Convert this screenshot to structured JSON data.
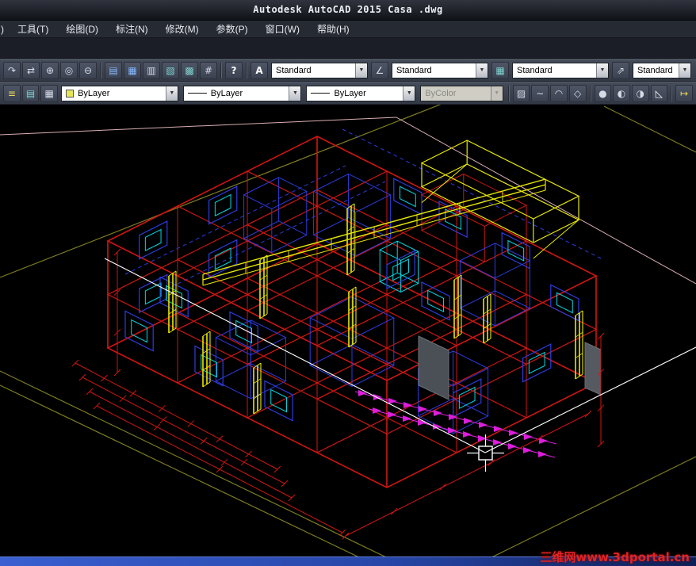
{
  "window": {
    "title": "Autodesk AutoCAD 2015   Casa .dwg"
  },
  "menubar": {
    "items": [
      {
        "label": ")"
      },
      {
        "label": "工具(T)"
      },
      {
        "label": "绘图(D)"
      },
      {
        "label": "标注(N)"
      },
      {
        "label": "修改(M)"
      },
      {
        "label": "参数(P)"
      },
      {
        "label": "窗口(W)"
      },
      {
        "label": "帮助(H)"
      }
    ]
  },
  "ui": {
    "dropdown_arrow": "▼"
  },
  "toolbar_row1": {
    "buttons": [
      {
        "name": "redo",
        "glyph": "↷"
      },
      {
        "name": "pan",
        "glyph": "⇄"
      },
      {
        "name": "zoom-in",
        "glyph": "⊕"
      },
      {
        "name": "zoom-realtime",
        "glyph": "◎"
      },
      {
        "name": "zoom-previous",
        "glyph": "⊖"
      },
      {
        "name": "save",
        "glyph": "▤"
      },
      {
        "name": "plot",
        "glyph": "▦"
      },
      {
        "name": "plot-preview",
        "glyph": "▥"
      },
      {
        "name": "publish",
        "glyph": "▧"
      },
      {
        "name": "table",
        "glyph": "▩"
      },
      {
        "name": "quickcalc",
        "glyph": "#"
      },
      {
        "name": "help",
        "glyph": "?"
      },
      {
        "name": "text-style",
        "glyph": "A"
      }
    ],
    "inter_icons": [
      {
        "name": "dim-style",
        "glyph": "∠"
      },
      {
        "name": "table-style",
        "glyph": "▦"
      },
      {
        "name": "multileader-style",
        "glyph": "⇗"
      }
    ],
    "combos": [
      {
        "name": "text-style",
        "value": "Standard"
      },
      {
        "name": "dim-style",
        "value": "Standard"
      },
      {
        "name": "table-style",
        "value": "Standard"
      },
      {
        "name": "multileader-style",
        "value": "Standard"
      }
    ]
  },
  "toolbar_row2": {
    "buttons_left": [
      {
        "name": "layer-properties",
        "glyph": "≡"
      },
      {
        "name": "layer-states",
        "glyph": "▤"
      },
      {
        "name": "layer-make-current",
        "glyph": "▦"
      }
    ],
    "color_combo": {
      "value": "ByLayer",
      "swatch_color": "#e6e65a"
    },
    "linetype_combo": {
      "value": "ByLayer"
    },
    "lineweight_combo": {
      "value": "ByLayer"
    },
    "plot_style_combo": {
      "value": "ByColor"
    },
    "buttons_right": [
      {
        "name": "match-properties",
        "glyph": "▨"
      },
      {
        "name": "polyline",
        "glyph": "∼"
      },
      {
        "name": "arc",
        "glyph": "◠"
      },
      {
        "name": "region",
        "glyph": "◇"
      },
      {
        "name": "render-sphere-1",
        "glyph": "●"
      },
      {
        "name": "render-sphere-2",
        "glyph": "◐"
      },
      {
        "name": "render-sphere-3",
        "glyph": "◑"
      },
      {
        "name": "face-tool",
        "glyph": "◺"
      },
      {
        "name": "measure",
        "glyph": "↦"
      }
    ]
  },
  "canvas": {
    "watermark": "三维网www.3dportal.cn"
  },
  "colors": {
    "wire_red": "#cf1612",
    "wire_blue": "#2e3ce0",
    "wire_cyan": "#00d9e6",
    "wire_yellow": "#e8e800",
    "wire_magenta": "#dc1edc",
    "site_olive": "#7d7d22",
    "roof_pink": "#d9aeb2",
    "cursor_white": "#ffffff"
  }
}
